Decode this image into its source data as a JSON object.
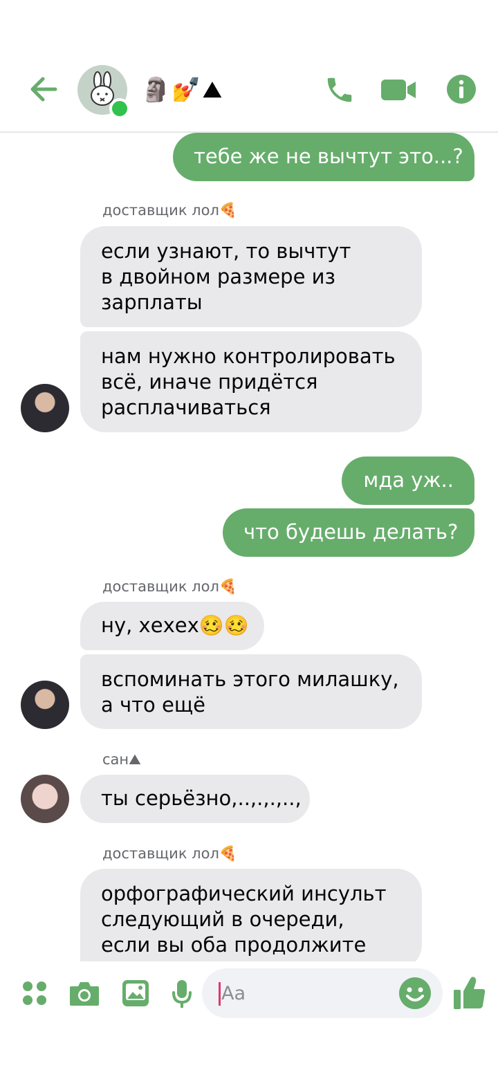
{
  "header": {
    "group_title": "🗿💅⛰",
    "colors": {
      "accent": "#66ad6b",
      "online": "#31c24d"
    },
    "icons": [
      "back-arrow-icon",
      "bunny-avatar-icon",
      "phone-icon",
      "video-camera-icon",
      "info-icon"
    ]
  },
  "messages": [
    {
      "dir": "out",
      "text": "тебе же не вычтут это...?"
    },
    {
      "sender": "доставщик лол🍕",
      "dir": "in",
      "text": "если узнают, то вычтут\nв двойном размере из\nзарплаты"
    },
    {
      "dir": "in",
      "text": "нам нужно контролировать\nвсё, иначе придётся\nрасплачиваться"
    },
    {
      "dir": "out",
      "text": "мда уж.."
    },
    {
      "dir": "out",
      "text": "что будешь делать?"
    },
    {
      "sender": "доставщик лол🍕",
      "dir": "in",
      "text": "ну, хехех🥴🥴"
    },
    {
      "dir": "in",
      "text": "вспоминать этого милашку,\nа что ещё"
    },
    {
      "sender": "сан⛰",
      "dir": "in",
      "text": "ты серьёзно,..,.,.,..,"
    },
    {
      "sender": "доставщик лол🍕",
      "dir": "in",
      "text": "орфографический инсульт\nследующий в очереди,\nесли вы оба продолжите"
    }
  ],
  "composer": {
    "placeholder": "Aa",
    "icons": [
      "apps-icon",
      "camera-icon",
      "gallery-icon",
      "microphone-icon",
      "emoji-icon",
      "thumbs-up-icon"
    ]
  }
}
